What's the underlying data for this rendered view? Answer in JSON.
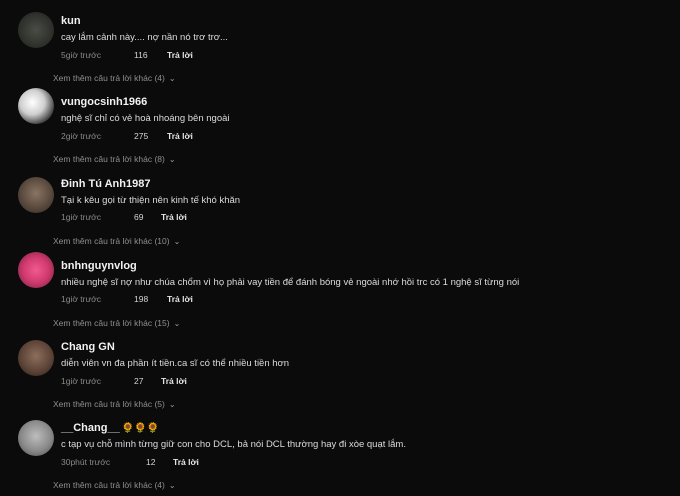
{
  "comments": [
    {
      "username": "kun",
      "text": "cay lắm cảnh này.... nợ nần nó trơ trơ...",
      "time": "5giờ trước",
      "likes": "116",
      "reply": "Trả lời",
      "more": "Xem thêm câu trả lời khác (4)",
      "avatar_color": "#3a3d36"
    },
    {
      "username": "vungocsinh1966",
      "text": "nghệ sĩ chỉ có vẻ hoà nhoáng bên ngoài",
      "time": "2giờ trước",
      "likes": "275",
      "reply": "Trả lời",
      "more": "Xem thêm câu trả lời khác (8)",
      "avatar_color": "#d8d8d8"
    },
    {
      "username": "Đinh Tú Anh1987",
      "text": "Tại k kêu gọi từ thiện nên kinh tế khó khăn",
      "time": "1giờ trước",
      "likes": "69",
      "reply": "Trả lời",
      "more": "Xem thêm câu trả lời khác (10)",
      "avatar_color": "#6b5a4c"
    },
    {
      "username": "bnhnguynvlog",
      "text": "nhiều nghệ sĩ nợ như chúa chổm vì họ phải vay tiền để đánh bóng vẻ ngoài nhớ hồi trc có 1 nghệ sĩ từng nói",
      "time": "1giờ trước",
      "likes": "198",
      "reply": "Trả lời",
      "more": "Xem thêm câu trả lời khác (15)",
      "avatar_color": "#d03a6e"
    },
    {
      "username": "Chang GN",
      "text": "diễn viên vn đa phần ít tiền.ca sĩ có thể nhiều tiền hơn",
      "time": "1giờ trước",
      "likes": "27",
      "reply": "Trả lời",
      "more": "Xem thêm câu trả lời khác (5)",
      "avatar_color": "#6e5446"
    },
    {
      "username": "__Chang__",
      "username_suffix": "🌻🌻🌻",
      "text": "c tạp vụ chỗ mình từng giữ con cho DCL, bả nói DCL thường hay đi xòe quạt lắm.",
      "time": "30phút trước",
      "likes": "12",
      "reply": "Trả lời",
      "more": "Xem thêm câu trả lời khác (4)",
      "avatar_color": "#9a9a9a"
    }
  ]
}
